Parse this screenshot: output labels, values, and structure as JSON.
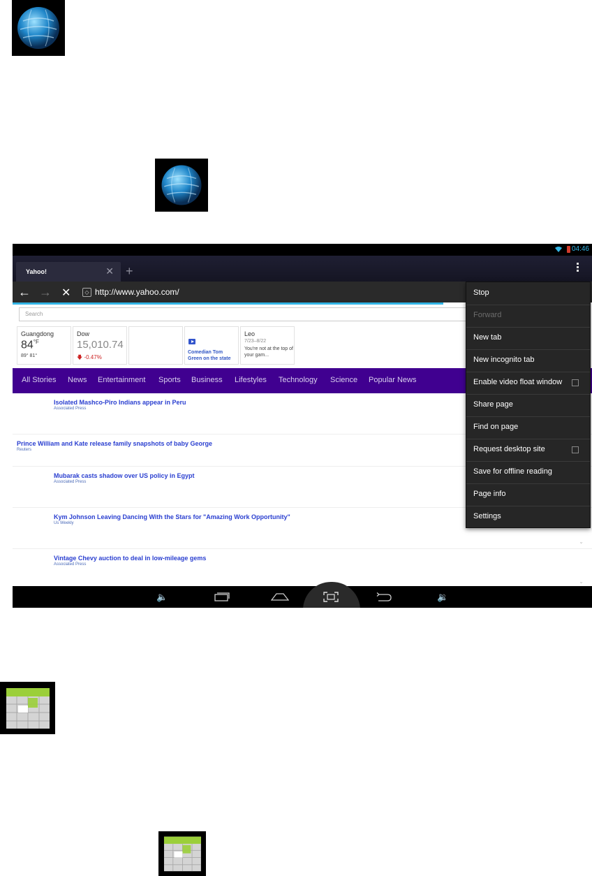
{
  "status": {
    "time": "04:46"
  },
  "browser": {
    "tab_title": "Yahoo!",
    "tab_close": "✕",
    "new_tab": "+",
    "url": "http://www.yahoo.com/",
    "back": "←",
    "forward": "→",
    "stop": "✕",
    "search_placeholder": "Search"
  },
  "cards": {
    "weather": {
      "city": "Guangdong",
      "temp": "84",
      "unit": "°F",
      "range": "89° 81°"
    },
    "dow": {
      "label": "Dow",
      "value": "15,010.74",
      "change": "-0.47%"
    },
    "video": {
      "title": "Comedian Tom Green on the state"
    },
    "horoscope": {
      "sign": "Leo",
      "dates": "7/23–8/22",
      "text": "You're not at the top of your gam..."
    }
  },
  "categories": [
    "All Stories",
    "News",
    "Entertainment",
    "Sports",
    "Business",
    "Lifestyles",
    "Technology",
    "Science",
    "Popular News"
  ],
  "stories": [
    {
      "headline": "Isolated Mashco-Piro Indians appear in Peru",
      "source": "Associated Press"
    },
    {
      "headline": "Prince William and Kate release family snapshots of baby George",
      "source": "Reuters"
    },
    {
      "headline": "Mubarak casts shadow over US policy in Egypt",
      "source": "Associated Press"
    },
    {
      "headline": "Kym Johnson Leaving Dancing With the Stars for \"Amazing Work Opportunity\"",
      "source": "Us Weekly"
    },
    {
      "headline": "Vintage Chevy auction to deal in low-mileage gems",
      "source": "Associated Press"
    }
  ],
  "menu": [
    {
      "label": "Stop",
      "enabled": true
    },
    {
      "label": "Forward",
      "enabled": false
    },
    {
      "label": "New tab",
      "enabled": true
    },
    {
      "label": "New incognito tab",
      "enabled": true
    },
    {
      "label": "Enable video float window",
      "enabled": true,
      "checkbox": true
    },
    {
      "label": "Share page",
      "enabled": true
    },
    {
      "label": "Find on page",
      "enabled": true
    },
    {
      "label": "Request desktop site",
      "enabled": true,
      "checkbox": true
    },
    {
      "label": "Save for offline reading",
      "enabled": true
    },
    {
      "label": "Page info",
      "enabled": true
    },
    {
      "label": "Settings",
      "enabled": true
    }
  ],
  "icons": {
    "browser_app": "globe-icon",
    "calendar_app": "calendar-icon",
    "nav": [
      "volume-down-icon",
      "recent-apps-icon",
      "home-icon",
      "screenshot-icon",
      "back-icon",
      "volume-up-icon"
    ]
  },
  "colors": {
    "yahoo_purple": "#400090",
    "accent_blue": "#33b5e5",
    "menu_bg": "#262626"
  }
}
